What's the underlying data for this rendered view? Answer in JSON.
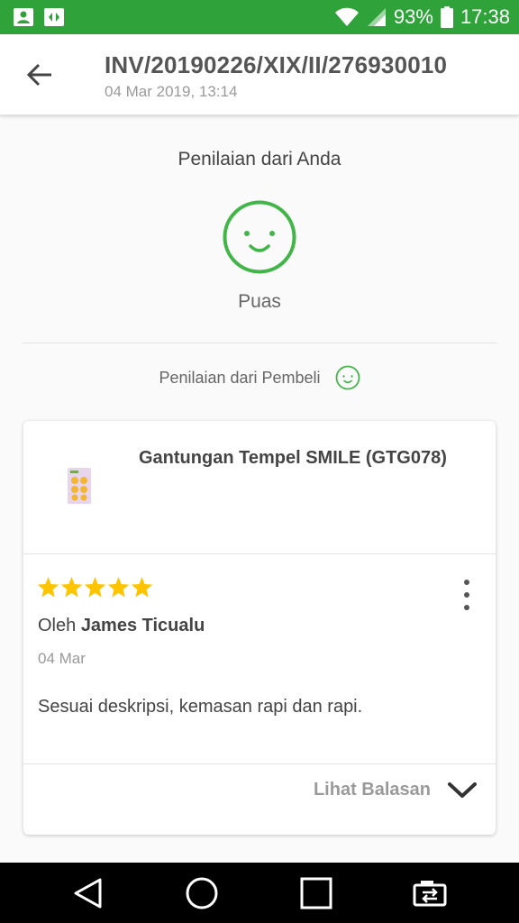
{
  "status_bar": {
    "battery": "93%",
    "time": "17:38",
    "colors": {
      "background": "#2fa33a"
    },
    "icons": [
      "contact-card-icon",
      "media-app-icon",
      "wifi-icon",
      "signal-icon",
      "battery-icon"
    ]
  },
  "header": {
    "title": "INV/20190226/XIX/II/276930010",
    "subtitle": "04 Mar 2019, 13:14"
  },
  "your_rating": {
    "label": "Penilaian dari Anda",
    "result": "Puas"
  },
  "buyer_rating": {
    "label": "Penilaian dari Pembeli"
  },
  "review_card": {
    "product_name": "Gantungan Tempel SMILE (GTG078)",
    "rating": 5,
    "rating_max": 5,
    "reviewer_prefix": "Oleh",
    "reviewer_name": "James Ticualu",
    "date": "04 Mar",
    "text": "Sesuai deskripsi, kemasan rapi dan rapi.",
    "reply_toggle_label": "Lihat Balasan"
  },
  "colors": {
    "accent_green": "#2fa33a",
    "smiley_green": "#42b549",
    "star_yellow": "#ffc400"
  },
  "nav_icons": [
    "back-triangle-icon",
    "home-circle-icon",
    "recents-square-icon",
    "screen-switch-icon"
  ]
}
